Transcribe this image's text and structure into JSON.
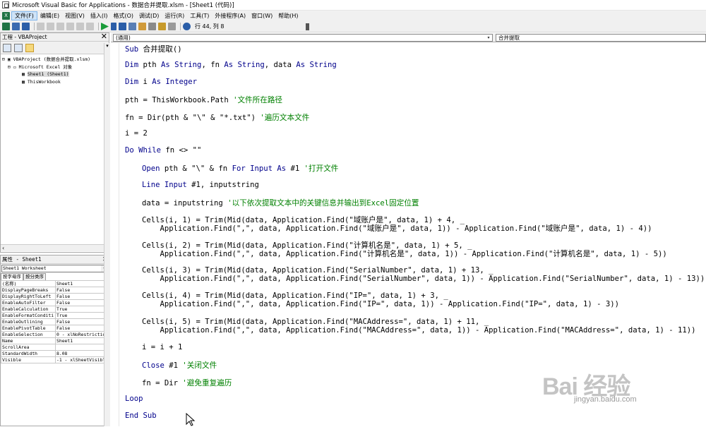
{
  "window": {
    "title": "Microsoft Visual Basic for Applications - 数据合并提取.xlsm - [Sheet1 (代码)]"
  },
  "menu": {
    "items": [
      "文件(F)",
      "编辑(E)",
      "视图(V)",
      "插入(I)",
      "格式(O)",
      "调试(D)",
      "运行(R)",
      "工具(T)",
      "外接程序(A)",
      "窗口(W)",
      "帮助(H)"
    ]
  },
  "toolbar": {
    "position": "行 44, 列 8"
  },
  "project_panel": {
    "title": "工程 - VBAProject",
    "tree": [
      "VBAProject (数据合并提取.xlsm)",
      "Microsoft Excel 对象",
      "Sheet1 (Sheet1)",
      "ThisWorkbook"
    ]
  },
  "properties_panel": {
    "title": "属性 - Sheet1",
    "object": "Sheet1 Worksheet",
    "tabs": [
      "按字母序",
      "按分类序"
    ],
    "rows": [
      [
        "(名称)",
        "Sheet1"
      ],
      [
        "DisplayPageBreaks",
        "False"
      ],
      [
        "DisplayRightToLeft",
        "False"
      ],
      [
        "EnableAutoFilter",
        "False"
      ],
      [
        "EnableCalculation",
        "True"
      ],
      [
        "EnableFormatConditi",
        "True"
      ],
      [
        "EnableOutlining",
        "False"
      ],
      [
        "EnablePivotTable",
        "False"
      ],
      [
        "EnableSelection",
        "0 - xlNoRestriction"
      ],
      [
        "Name",
        "Sheet1"
      ],
      [
        "ScrollArea",
        ""
      ],
      [
        "StandardWidth",
        "8.08"
      ],
      [
        "Visible",
        "-1 - xlSheetVisible"
      ]
    ]
  },
  "editor": {
    "object_combo": "(通用)",
    "proc_combo": "合并提取",
    "lines": [
      [
        "Sub",
        " 合并提取()",
        ""
      ],
      [
        "Dim",
        " pth ",
        "As String",
        ", fn ",
        "As String",
        ", data ",
        "As String"
      ],
      [
        "Dim",
        " i ",
        "As Integer"
      ],
      [
        "",
        "pth = ThisWorkbook.Path ",
        "'文件所在路径"
      ],
      [
        "",
        "fn = Dir(pth & \"\\\" & \"*.txt\") ",
        "'遍历文本文件"
      ],
      [
        "",
        "i = 2",
        ""
      ],
      [
        "Do While",
        " fn <> \"\""
      ],
      [
        "Open",
        " pth & \"\\\" & fn ",
        "For Input As",
        " #1 ",
        "'打开文件"
      ],
      [
        "Line Input",
        " #1, inputstring"
      ],
      [
        "",
        "data = inputstring ",
        "'以下依次提取文本中的关键信息并输出到Excel固定位置"
      ],
      [
        "",
        "Cells(i, 1) = Trim(Mid(data, Application.Find(\"域账户是\", data, 1) + 4, _"
      ],
      [
        "",
        "    Application.Find(\",\", data, Application.Find(\"域账户是\", data, 1)) - Application.Find(\"域账户是\", data, 1) - 4))"
      ],
      [
        "",
        "Cells(i, 2) = Trim(Mid(data, Application.Find(\"计算机名是\", data, 1) + 5, _"
      ],
      [
        "",
        "    Application.Find(\",\", data, Application.Find(\"计算机名是\", data, 1)) - Application.Find(\"计算机名是\", data, 1) - 5))"
      ],
      [
        "",
        "Cells(i, 3) = Trim(Mid(data, Application.Find(\"SerialNumber\", data, 1) + 13, _"
      ],
      [
        "",
        "    Application.Find(\",\", data, Application.Find(\"SerialNumber\", data, 1)) - Application.Find(\"SerialNumber\", data, 1) - 13))"
      ],
      [
        "",
        "Cells(i, 4) = Trim(Mid(data, Application.Find(\"IP=\", data, 1) + 3, _"
      ],
      [
        "",
        "    Application.Find(\",\", data, Application.Find(\"IP=\", data, 1)) - Application.Find(\"IP=\", data, 1) - 3))"
      ],
      [
        "",
        "Cells(i, 5) = Trim(Mid(data, Application.Find(\"MACAddress=\", data, 1) + 11, _"
      ],
      [
        "",
        "    Application.Find(\",\", data, Application.Find(\"MACAddress=\", data, 1)) - Application.Find(\"MACAddress=\", data, 1) - 11))"
      ],
      [
        "",
        "i = i + 1"
      ],
      [
        "Close",
        " #1 ",
        "'关闭文件"
      ],
      [
        "",
        "fn = Dir ",
        "'避免重复遍历"
      ],
      [
        "Loop",
        ""
      ],
      [
        "End Sub",
        ""
      ]
    ]
  },
  "watermark": {
    "logo": "Bai 经验",
    "url": "jingyan.baidu.com"
  },
  "colors": {
    "keyword": "#00008b",
    "comment": "#008000"
  }
}
